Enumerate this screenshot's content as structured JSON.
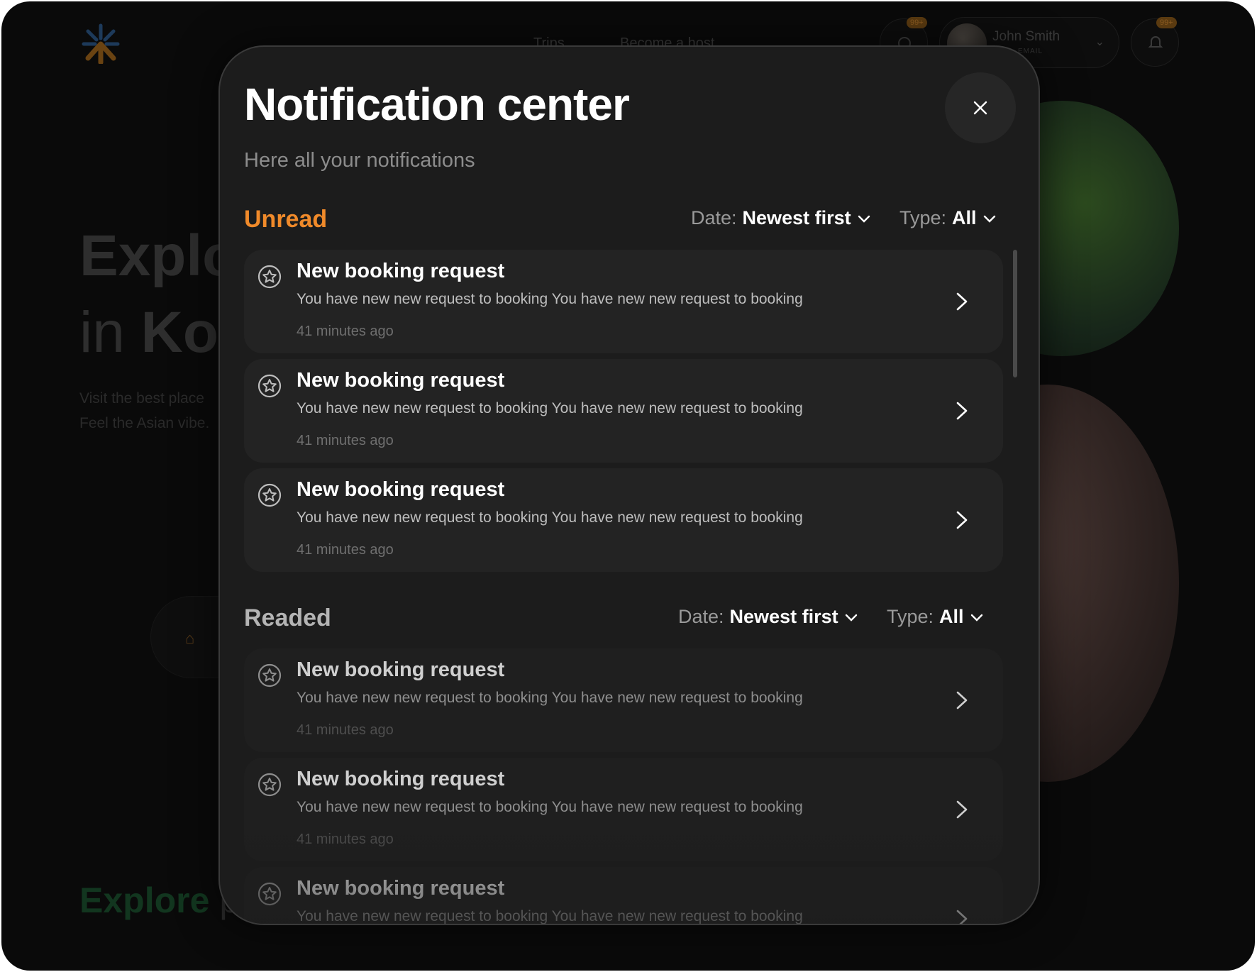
{
  "background": {
    "nav": {
      "trips": "Trips",
      "become_host": "Become a host"
    },
    "badges": {
      "messages": "99+",
      "notifications": "99+"
    },
    "user": {
      "name": "John Smith",
      "subtitle": "EMAIL"
    },
    "hero": {
      "line1": "Explo",
      "line2_prefix": "in ",
      "line2_bold": "Kor",
      "sub1": "Visit the best  place",
      "sub2": "Feel the Asian vibe."
    },
    "search_label": "h",
    "explore_title": "Explore",
    "explore_rest": "p",
    "accent_green": "#12361f"
  },
  "modal": {
    "title": "Notification center",
    "subtitle": "Here all your notifications",
    "close_icon": "close-icon",
    "accent": "#f08a2a",
    "unread": {
      "heading": "Unread",
      "date_filter_label": "Date:",
      "date_filter_value": "Newest first",
      "type_filter_label": "Type:",
      "type_filter_value": "All",
      "items": [
        {
          "title": "New booking request",
          "body": "You have new  new request to booking You have new  new request to booking",
          "time": "41 minutes ago"
        },
        {
          "title": "New booking request",
          "body": "You have new  new request to booking You have new  new request to booking",
          "time": "41 minutes ago"
        },
        {
          "title": "New booking request",
          "body": "You have new  new request to booking You have new  new request to booking",
          "time": "41 minutes ago"
        }
      ]
    },
    "readed": {
      "heading": "Readed",
      "date_filter_label": "Date:",
      "date_filter_value": "Newest first",
      "type_filter_label": "Type:",
      "type_filter_value": "All",
      "items": [
        {
          "title": "New booking request",
          "body": "You have new  new request to booking You have new  new request to booking",
          "time": "41 minutes ago"
        },
        {
          "title": "New booking request",
          "body": "You have new  new request to booking You have new  new request to booking",
          "time": "41 minutes ago"
        },
        {
          "title": "New booking request",
          "body": "You have new  new request to booking You have new  new request to booking",
          "time": ""
        }
      ]
    }
  }
}
